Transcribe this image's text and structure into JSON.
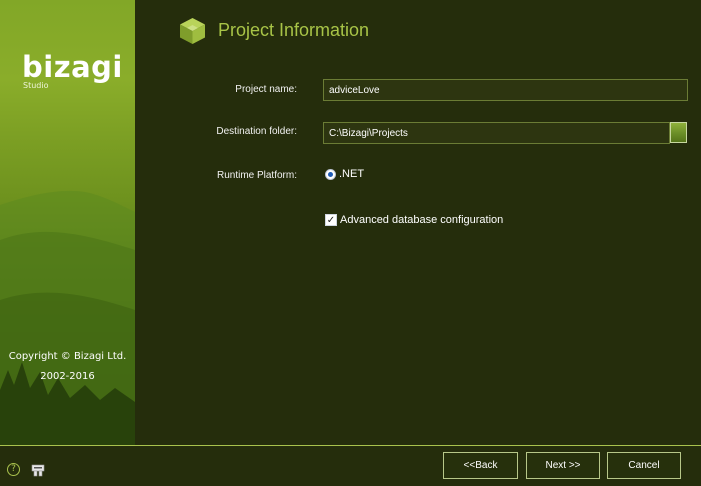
{
  "sidebar": {
    "logo_text": "bizagi",
    "logo_sub": "Studio",
    "copyright_line1": "Copyright © Bizagi Ltd.",
    "copyright_line2": "2002-2016"
  },
  "header": {
    "title": "Project Information",
    "icon": "cube-icon"
  },
  "form": {
    "project_name_label": "Project name:",
    "project_name_value": "adviceLove",
    "destination_label": "Destination folder:",
    "destination_value": "C:\\Bizagi\\Projects",
    "runtime_label": "Runtime Platform:",
    "runtime_option": ".NET",
    "runtime_selected": true,
    "advanced_db_label": "Advanced database configuration",
    "advanced_db_checked": true
  },
  "footer": {
    "back_label": "<<Back",
    "next_label": "Next >>",
    "cancel_label": "Cancel",
    "help_icon": "help-icon",
    "tools_icon": "tools-icon"
  },
  "colors": {
    "background": "#252d0c",
    "accent": "#a8c447",
    "sidebar_green": "#82a727"
  }
}
